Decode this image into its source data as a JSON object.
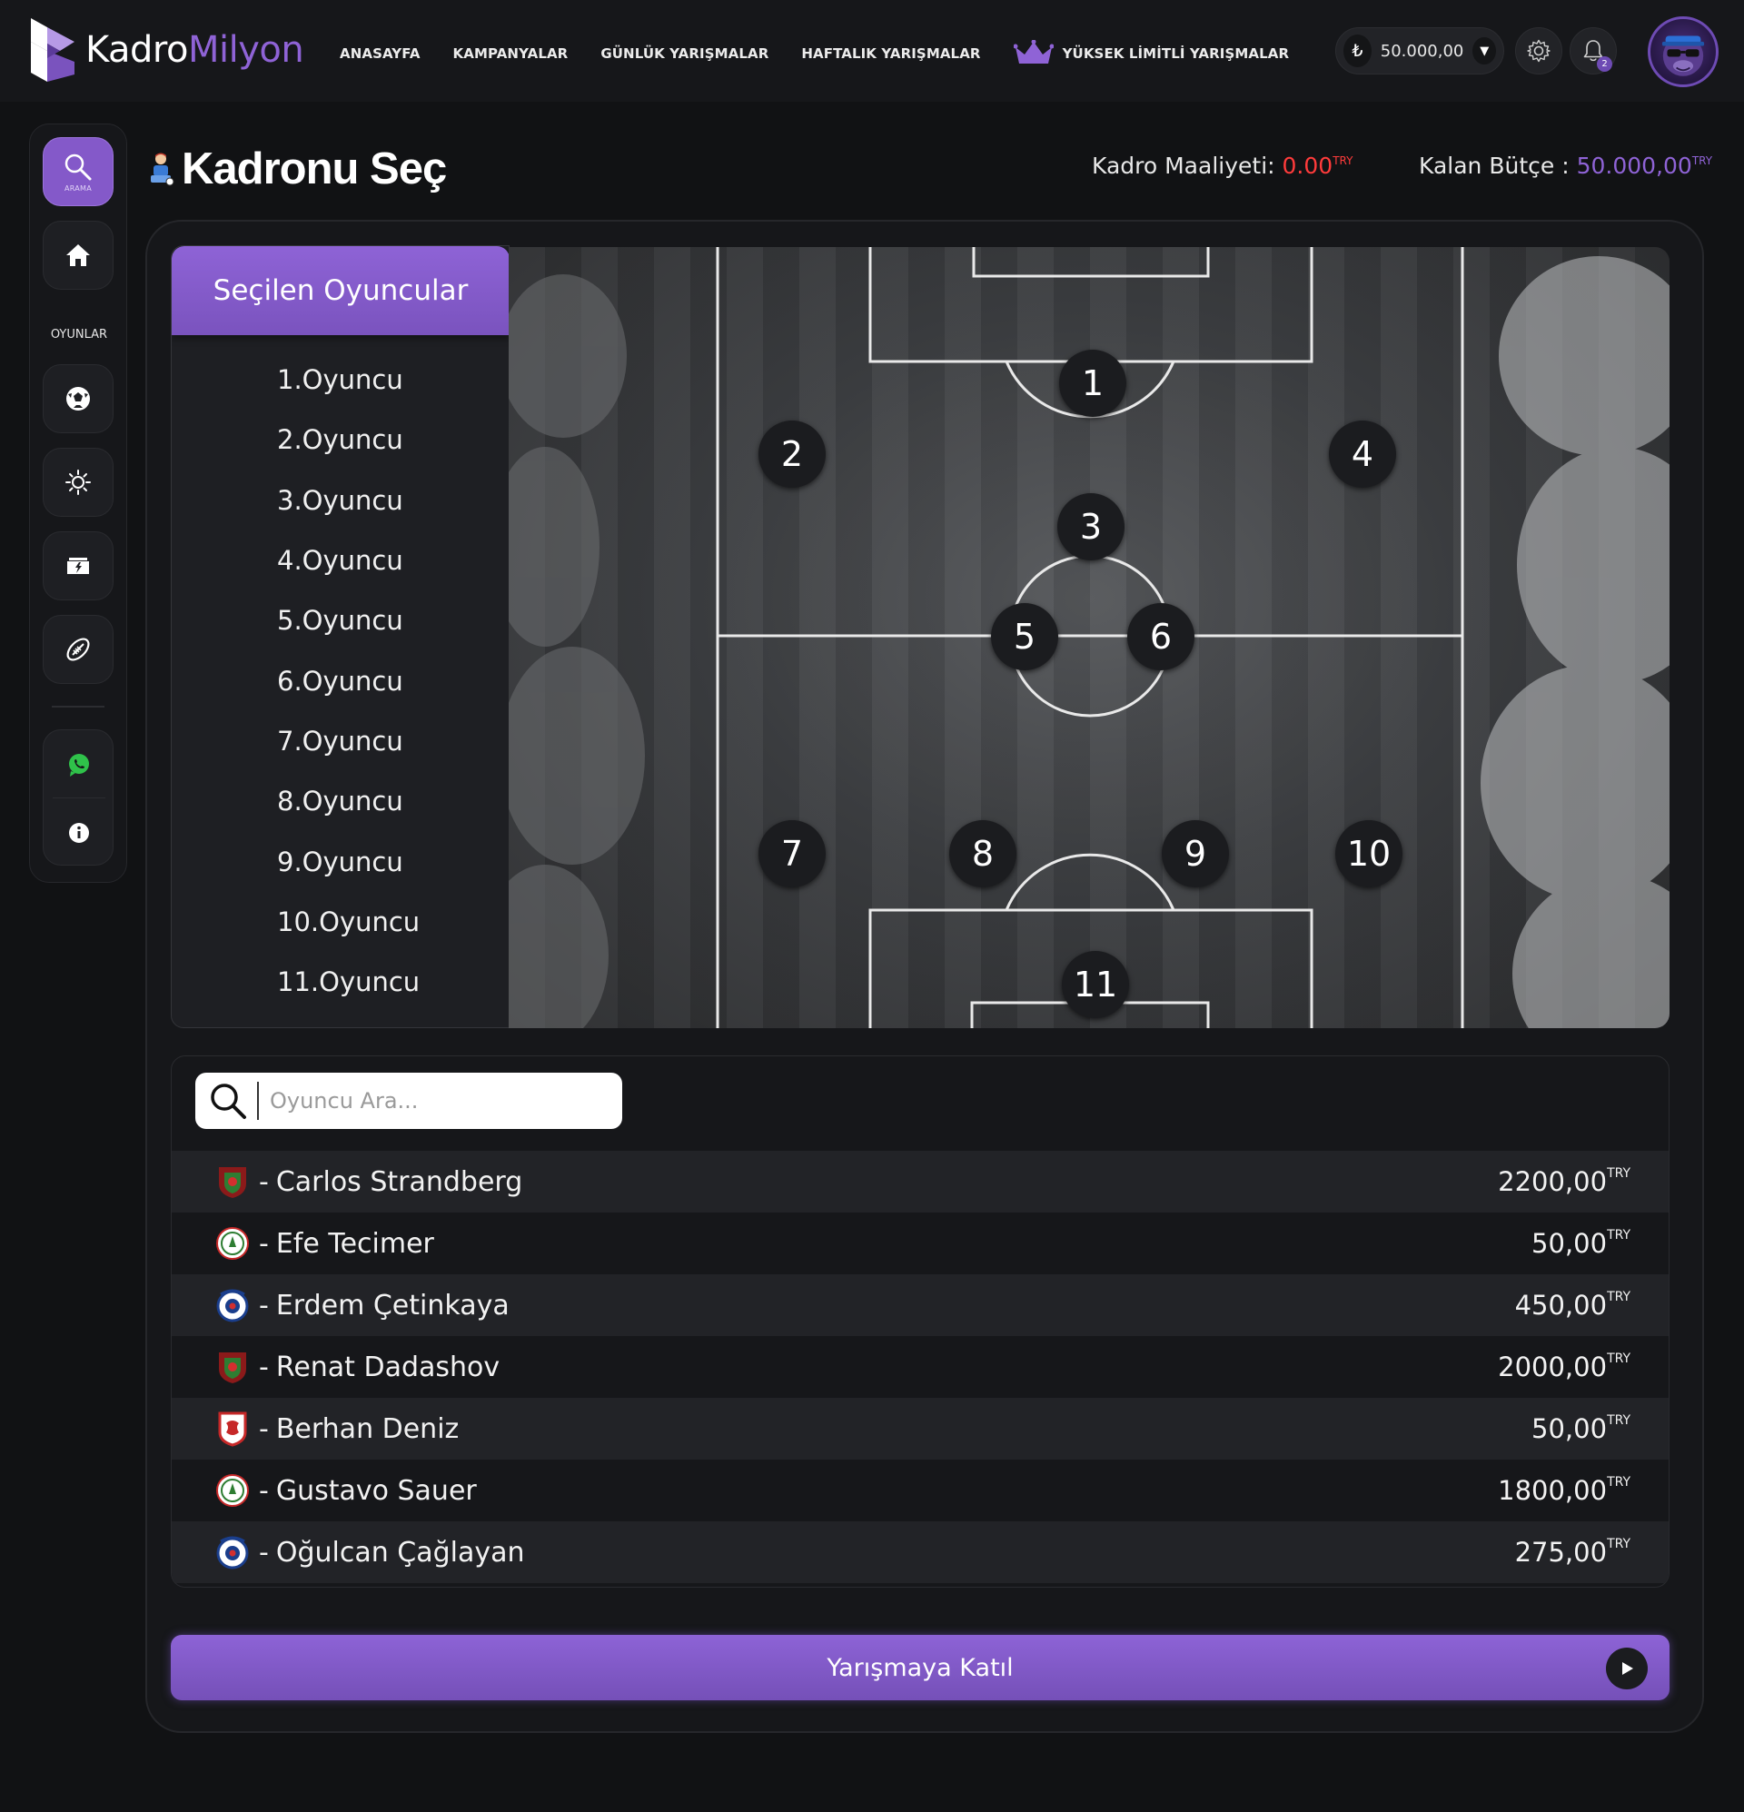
{
  "app": {
    "logo_part1": "Kadro",
    "logo_part2": "Milyon",
    "accent_color": "#8459c9"
  },
  "nav": {
    "items": [
      "ANASAYFA",
      "KAMPANYALAR",
      "GÜNLÜK YARIŞMALAR",
      "HAFTALIK YARIŞMALAR"
    ],
    "premium_label": "YÜKSEK LİMİTLİ YARIŞMALAR",
    "premium_icon": "crown-icon"
  },
  "account": {
    "currency_symbol": "₺",
    "balance": "50.000,00",
    "notification_count": "2"
  },
  "sidebar": {
    "search_label": "ARAMA",
    "section_label": "OYUNLAR",
    "icons": [
      "search-icon",
      "home-icon",
      "football-icon",
      "sun-icon",
      "lightning-board-icon",
      "rugby-ball-icon",
      "whatsapp-icon",
      "info-icon"
    ]
  },
  "title": {
    "text": "Kadronu Seç",
    "cost_label": "Kadro Maaliyeti:",
    "cost_value": "0.00",
    "budget_label": "Kalan Bütçe :",
    "budget_value": "50.000,00",
    "currency_suffix": "TRY"
  },
  "selected": {
    "header": "Seçilen Oyuncular",
    "slots": [
      "1.Oyuncu",
      "2.Oyuncu",
      "3.Oyuncu",
      "4.Oyuncu",
      "5.Oyuncu",
      "6.Oyuncu",
      "7.Oyuncu",
      "8.Oyuncu",
      "9.Oyuncu",
      "10.Oyuncu",
      "11.Oyuncu"
    ]
  },
  "pitch": {
    "positions": [
      "1",
      "2",
      "3",
      "4",
      "5",
      "6",
      "7",
      "8",
      "9",
      "10",
      "11"
    ]
  },
  "players": {
    "search_placeholder": "Oyuncu Ara...",
    "currency_suffix": "TRY",
    "rows": [
      {
        "club_icon": "hatayspor-crest-icon",
        "name": "Carlos Strandberg",
        "price": "2200,00"
      },
      {
        "club_icon": "rizespor-crest-icon",
        "name": "Efe Tecimer",
        "price": "50,00"
      },
      {
        "club_icon": "kasimpasa-crest-icon",
        "name": "Erdem Çetinkaya",
        "price": "450,00"
      },
      {
        "club_icon": "hatayspor-crest-icon",
        "name": "Renat Dadashov",
        "price": "2000,00"
      },
      {
        "club_icon": "samsunspor-crest-icon",
        "name": "Berhan Deniz",
        "price": "50,00"
      },
      {
        "club_icon": "rizespor-crest-icon",
        "name": "Gustavo Sauer",
        "price": "1800,00"
      },
      {
        "club_icon": "kasimpasa-crest-icon",
        "name": "Oğulcan Çağlayan",
        "price": "275,00"
      }
    ]
  },
  "join_button": "Yarışmaya Katıl"
}
